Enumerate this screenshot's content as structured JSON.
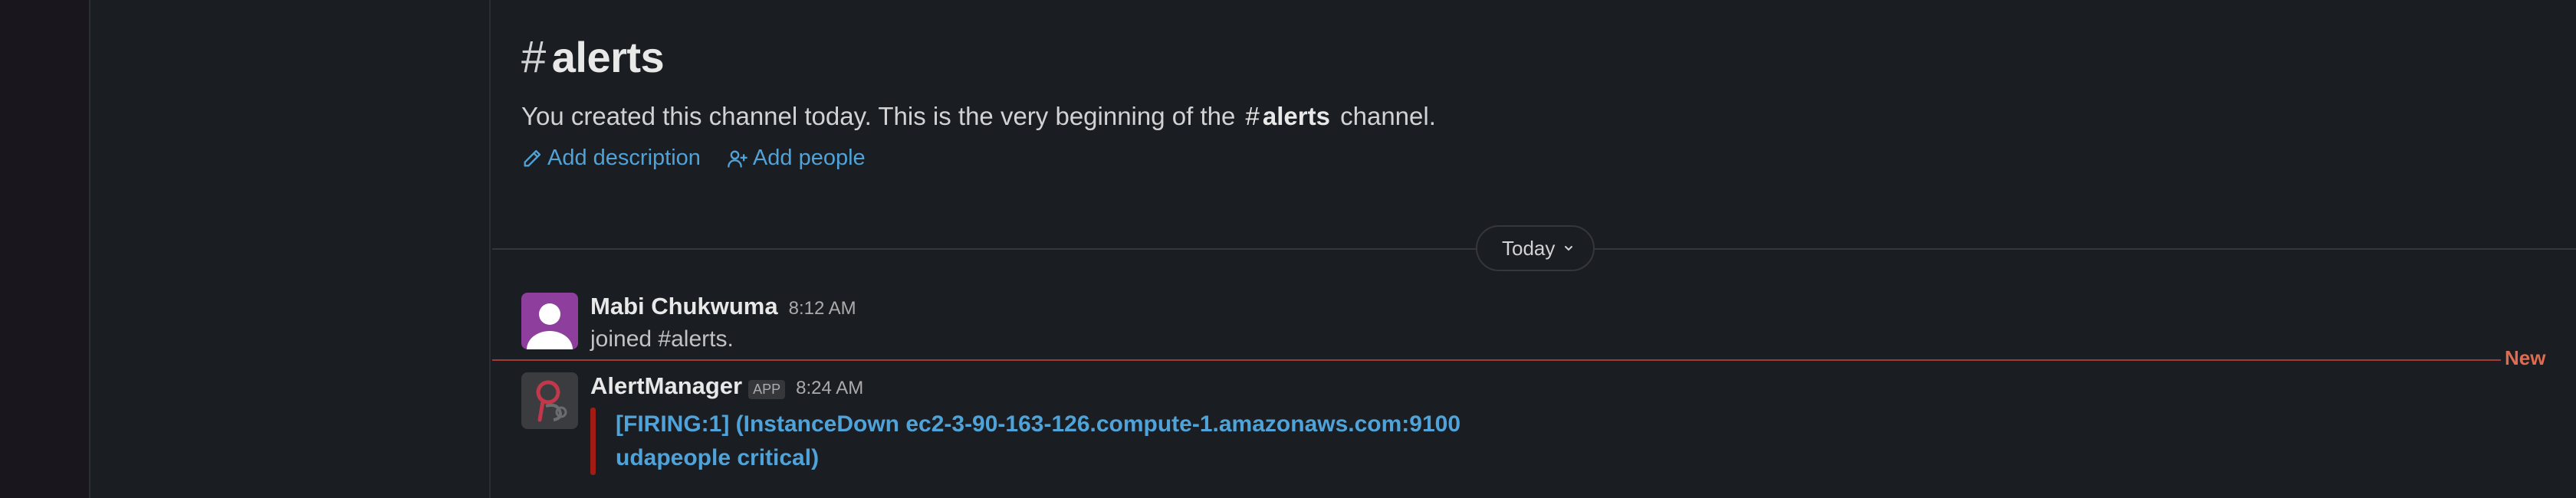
{
  "channel": {
    "hash": "#",
    "name": "alerts",
    "intro_prefix": "You created this channel today. This is the very beginning of the",
    "intro_hash": "#",
    "intro_channel": "alerts",
    "intro_suffix": "channel.",
    "add_description": "Add description",
    "add_people": "Add people"
  },
  "day_divider": {
    "label": "Today"
  },
  "messages": [
    {
      "sender": "Mabi Chukwuma",
      "time": "8:12 AM",
      "text": "joined #alerts."
    },
    {
      "sender": "AlertManager",
      "badge": "APP",
      "time": "8:24 AM",
      "attachment_line1": "[FIRING:1]  (InstanceDown ec2-3-90-163-126.compute-1.amazonaws.com:9100",
      "attachment_line2": "udapeople critical)"
    }
  ],
  "new_marker": "New",
  "colors": {
    "accent": "#4fa3d9",
    "new": "#e06b4f",
    "alert": "#a01c14",
    "avatar_purple": "#8e3f9d"
  },
  "icons": {
    "add_description": "pencil-icon",
    "add_people": "add-person-icon",
    "day_pill": "chevron-down-icon"
  }
}
